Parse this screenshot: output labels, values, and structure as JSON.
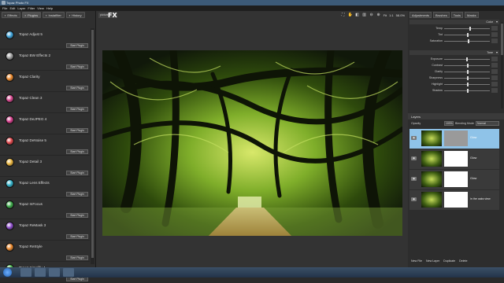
{
  "window": {
    "title": "Topaz Photo FX"
  },
  "menu": [
    "File",
    "Edit",
    "Layer",
    "Filter",
    "View",
    "Help"
  ],
  "left_tabs": [
    {
      "label": "Effects",
      "icon": "effects-icon"
    },
    {
      "label": "Plugins",
      "icon": "plugin-icon"
    },
    {
      "label": "Instafilter",
      "icon": "instafilter-icon"
    },
    {
      "label": "History",
      "icon": "history-icon"
    }
  ],
  "plugins": [
    {
      "name": "Topaz Adjust 5",
      "color": "#3aa0d8",
      "button": "Start Plugin"
    },
    {
      "name": "Topaz BW Effects 2",
      "color": "#9c9c9c",
      "button": "Start Plugin"
    },
    {
      "name": "Topaz Clarity",
      "color": "#e8862a",
      "button": "Start Plugin"
    },
    {
      "name": "Topaz Clean 3",
      "color": "#d4458c",
      "button": "Start Plugin"
    },
    {
      "name": "Topaz DeJPEG 4",
      "color": "#d43c8a",
      "button": "Start Plugin"
    },
    {
      "name": "Topaz DeNoise 5",
      "color": "#e0464a",
      "button": "Start Plugin"
    },
    {
      "name": "Topaz Detail 3",
      "color": "#e8b33a",
      "button": "Start Plugin"
    },
    {
      "name": "Topaz Lens Effects",
      "color": "#2fb0c8",
      "button": "Start Plugin"
    },
    {
      "name": "Topaz InFocus",
      "color": "#3aa846",
      "button": "Start Plugin"
    },
    {
      "name": "Topaz ReMask 3",
      "color": "#8a4ac8",
      "button": "Start Plugin"
    },
    {
      "name": "Topaz ReStyle",
      "color": "#e8862a",
      "button": "Start Plugin"
    },
    {
      "name": "Topaz Simplify 4",
      "color": "#4ab84a",
      "button": "Start Plugin"
    }
  ],
  "doc_tab": "picture",
  "fx_logo": "FX",
  "toolbar": {
    "zoom_fit": "Fit",
    "zoom_1to1": "1:1",
    "zoom_pct": "58.0%"
  },
  "right_tabs": [
    {
      "label": "Adjustments"
    },
    {
      "label": "Brushes"
    },
    {
      "label": "Tools"
    },
    {
      "label": "Masks"
    }
  ],
  "color_section": {
    "label": "Color",
    "rows": [
      {
        "label": "Temp",
        "level": 0.55
      },
      {
        "label": "Tint",
        "level": 0.5
      },
      {
        "label": "Saturation",
        "level": 0.52
      }
    ]
  },
  "tone_section": {
    "label": "Tone",
    "rows": [
      {
        "label": "Exposure",
        "level": 0.48
      },
      {
        "label": "Contrast",
        "level": 0.5
      },
      {
        "label": "Clarity",
        "level": 0.5
      },
      {
        "label": "Sharpness",
        "level": 0.5
      },
      {
        "label": "Highlight",
        "level": 0.5
      },
      {
        "label": "Shadow",
        "level": 0.5
      }
    ]
  },
  "layers_panel": {
    "title": "Layers",
    "opacity_label": "Opacity",
    "opacity_value": "100%",
    "blend_label": "Blending Mode",
    "blend_value": "Normal",
    "layers": [
      {
        "name": "Glow",
        "selected": true,
        "mask": "grey"
      },
      {
        "name": "Glow",
        "selected": false,
        "mask": "white"
      },
      {
        "name": "Glow",
        "selected": false,
        "mask": "white"
      },
      {
        "name": "in the oaks view",
        "selected": false,
        "mask": "white"
      }
    ],
    "bottom": [
      "New File",
      "New Layer",
      "Duplicate",
      "Delete"
    ]
  },
  "colors": {
    "accent": "#8fc3e8",
    "panel": "#2d2d2d",
    "canvas_bg": "#333333"
  }
}
